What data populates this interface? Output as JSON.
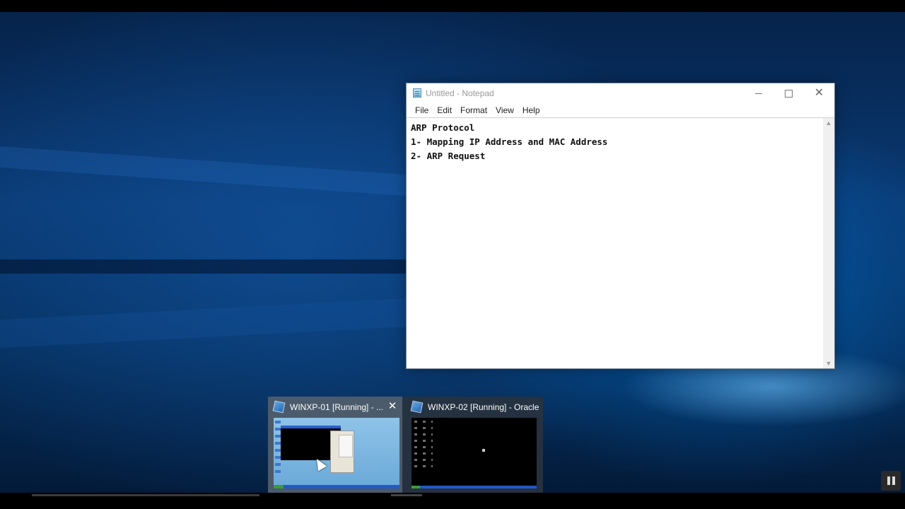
{
  "notepad": {
    "title": "Untitled - Notepad",
    "menu": [
      "File",
      "Edit",
      "Format",
      "View",
      "Help"
    ],
    "lines": [
      "ARP Protocol",
      "1- Mapping IP Address and MAC Address",
      "2- ARP Request"
    ]
  },
  "taskbar_preview": {
    "items": [
      {
        "title": "WINXP-01 [Running] - ...",
        "icon": "virtualbox-icon"
      },
      {
        "title": "WINXP-02 [Running] - Oracle...",
        "icon": "virtualbox-icon"
      }
    ]
  },
  "player": {
    "pause_icon": "pause-icon"
  }
}
